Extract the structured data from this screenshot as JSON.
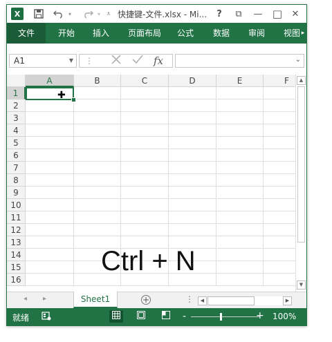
{
  "titlebar": {
    "app_logo": "X",
    "title": "快捷键-文件.xlsx - Mi...",
    "icons": {
      "save": "save-icon",
      "undo": "undo-icon",
      "redo": "redo-icon",
      "customize": "customize-qat-icon"
    },
    "help": "?",
    "restore": "⧉",
    "minimize": "—",
    "maximize": "□",
    "close": "✕"
  },
  "ribbon": {
    "tabs": [
      "文件",
      "开始",
      "插入",
      "页面布局",
      "公式",
      "数据",
      "审阅",
      "视图"
    ],
    "scroll": "▸"
  },
  "formula_bar": {
    "name_box": "A1",
    "fx_label": "fx",
    "value": ""
  },
  "grid": {
    "columns": [
      "A",
      "B",
      "C",
      "D",
      "E",
      "F"
    ],
    "rows": [
      "1",
      "2",
      "3",
      "4",
      "5",
      "6",
      "7",
      "8",
      "9",
      "10",
      "11",
      "12",
      "13",
      "14",
      "15",
      "16"
    ],
    "active_cell": "A1",
    "overlay_text": "Ctrl + N"
  },
  "sheets": {
    "tabs": [
      "Sheet1"
    ],
    "active": "Sheet1",
    "add_label": "+",
    "nav_prev": "◂",
    "nav_next": "▸",
    "dots": "⋮"
  },
  "statusbar": {
    "ready": "就绪",
    "zoom_minus": "-",
    "zoom_plus": "+",
    "zoom_level": "100%"
  },
  "colors": {
    "accent": "#217346",
    "file_tab": "#1a5c38",
    "header_bg": "#f3f3f3"
  }
}
